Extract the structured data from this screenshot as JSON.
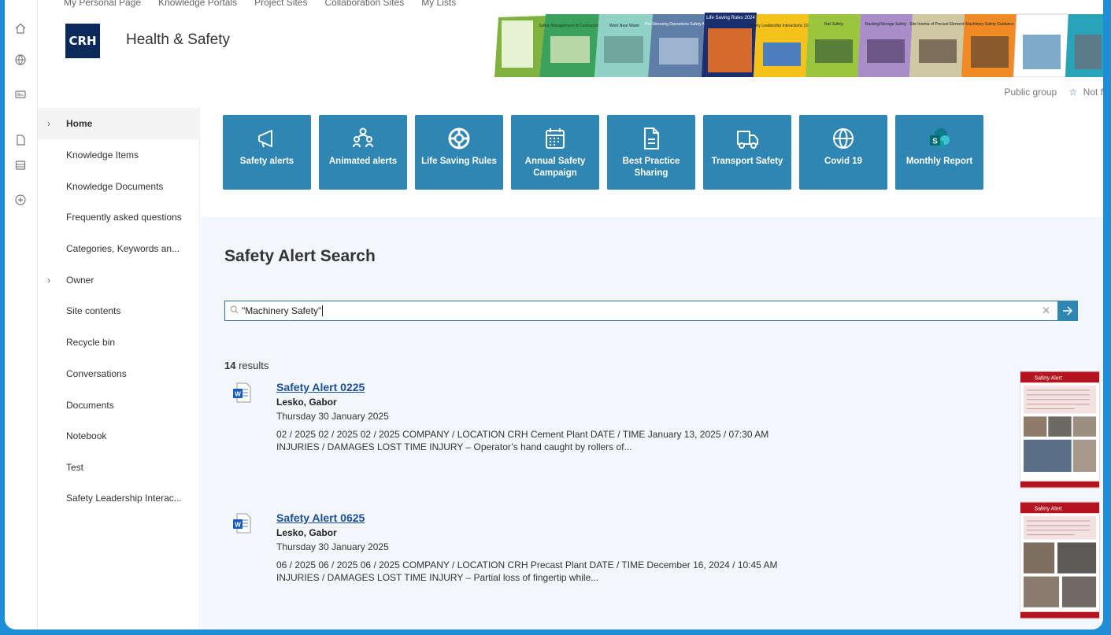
{
  "header": {
    "top_nav": [
      "My Personal Page",
      "Knowledge Portals",
      "Project Sites",
      "Collaboration Sites",
      "My Lists"
    ],
    "logo_text": "CRH",
    "site_title": "Health & Safety",
    "group_label": "Public group",
    "follow_label": "Not f",
    "banner_texts": [
      "Safety Management of Contractors",
      "Work Near Water",
      "Pre Stressing Operations Safety Audit",
      "Life Saving Rules 2024",
      "Safety Leadership Interactions (SLIs)",
      "Rail Safety",
      "Racking/Storage Safety",
      "Site Intertia of Precast Elements",
      "Machinery Safety Guidance"
    ]
  },
  "leftnav": {
    "items": [
      {
        "label": "Home",
        "chevron": true,
        "active": true
      },
      {
        "label": "Knowledge Items"
      },
      {
        "label": "Knowledge Documents"
      },
      {
        "label": "Frequently asked questions"
      },
      {
        "label": "Categories, Keywords an..."
      },
      {
        "label": "Owner",
        "chevron": true
      },
      {
        "label": "Site contents"
      },
      {
        "label": "Recycle bin"
      },
      {
        "label": "Conversations"
      },
      {
        "label": "Documents"
      },
      {
        "label": "Notebook"
      },
      {
        "label": "Test"
      },
      {
        "label": "Safety Leadership Interac..."
      }
    ]
  },
  "tiles": [
    {
      "label": "Safety alerts",
      "icon": "megaphone-icon"
    },
    {
      "label": "Animated alerts",
      "icon": "people-group-icon"
    },
    {
      "label": "Life Saving Rules",
      "icon": "lifebuoy-icon"
    },
    {
      "label": "Annual Safety Campaign",
      "icon": "calendar-icon"
    },
    {
      "label": "Best Practice Sharing",
      "icon": "document-icon"
    },
    {
      "label": "Transport Safety",
      "icon": "truck-icon"
    },
    {
      "label": "Covid 19",
      "icon": "globe-icon"
    },
    {
      "label": "Monthly Report",
      "icon": "sharepoint-icon"
    }
  ],
  "search": {
    "title": "Safety Alert Search",
    "query": "\"Machinery Safety\"",
    "result_count": "14",
    "result_word": "results",
    "results": [
      {
        "title": "Safety Alert 0225",
        "author": "Lesko, Gabor",
        "date": "Thursday 30 January 2025",
        "snippet_line1": "02 / 2025 02 / 2025 02 / 2025 COMPANY / LOCATION CRH Cement Plant DATE / TIME January 13, 2025 / 07:30 AM",
        "snippet_line2": "INJURIES / DAMAGES LOST TIME INJURY – Operator’s hand caught by rollers of...",
        "thumb_label": "Safety Alert"
      },
      {
        "title": "Safety Alert 0625",
        "author": "Lesko, Gabor",
        "date": "Thursday 30 January 2025",
        "snippet_line1": "06 / 2025 06 / 2025 06 / 2025 COMPANY / LOCATION CRH Precast Plant DATE / TIME December 16, 2024 / 10:45 AM",
        "snippet_line2": "INJURIES / DAMAGES LOST TIME INJURY – Partial loss of fingertip while...",
        "thumb_label": "Safety Alert"
      }
    ]
  },
  "colors": {
    "tile": "#2f86b2",
    "link": "#1a4f9a",
    "frame": "#1e8ed6",
    "search_bg": "#f3f7fb"
  }
}
